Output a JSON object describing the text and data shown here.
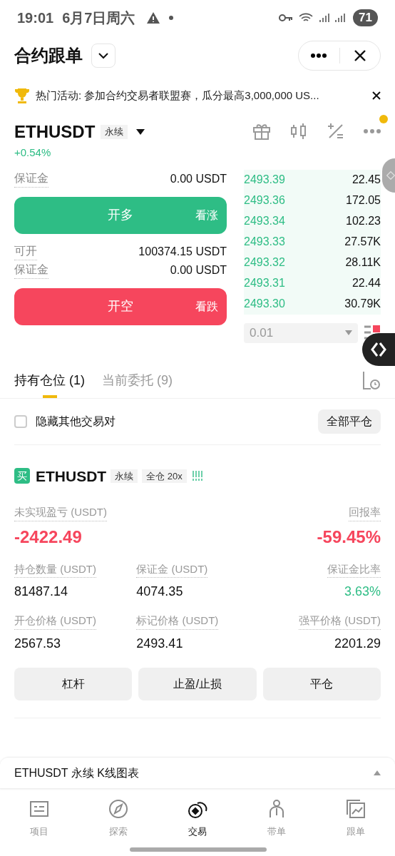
{
  "status_bar": {
    "time": "19:01",
    "date": "6月7日周六",
    "battery": "71"
  },
  "header": {
    "title": "合约跟单"
  },
  "banner": {
    "text": "热门活动: 参加合约交易者联盟赛，瓜分最高3,000,000 US..."
  },
  "ticker": {
    "symbol": "ETHUSDT",
    "type": "永续",
    "change": "+0.54%"
  },
  "order_form": {
    "sections": [
      {
        "kind": "long",
        "rows": [
          {
            "label": "保证金",
            "value": "0.00 USDT"
          }
        ],
        "button": "开多",
        "hint": "看涨"
      },
      {
        "kind": "short",
        "rows": [
          {
            "label": "可开",
            "value": "100374.15 USDT"
          },
          {
            "label": "保证金",
            "value": "0.00 USDT"
          }
        ],
        "button": "开空",
        "hint": "看跌"
      }
    ]
  },
  "order_book": {
    "rows": [
      {
        "price": "2493.39",
        "qty": "22.45"
      },
      {
        "price": "2493.36",
        "qty": "172.05"
      },
      {
        "price": "2493.34",
        "qty": "102.23"
      },
      {
        "price": "2493.33",
        "qty": "27.57K"
      },
      {
        "price": "2493.32",
        "qty": "28.11K"
      },
      {
        "price": "2493.31",
        "qty": "22.44"
      },
      {
        "price": "2493.30",
        "qty": "30.79K"
      }
    ],
    "precision": "0.01"
  },
  "tabs": [
    {
      "label": "持有仓位 (1)",
      "selected": true
    },
    {
      "label": "当前委托 (9)",
      "selected": false
    }
  ],
  "filter": {
    "label": "隐藏其他交易对",
    "checked": false,
    "close_all": "全部平仓"
  },
  "position": {
    "side": "买",
    "symbol": "ETHUSDT",
    "tags": [
      "永续",
      "全仓 20x"
    ],
    "pnl_label": "未实现盈亏 (USDT)",
    "pnl": "-2422.49",
    "roe_label": "回报率",
    "roe": "-59.45%",
    "stats": [
      {
        "label": "持仓数量 (USDT)",
        "value": "81487.14",
        "kind": "plain"
      },
      {
        "label": "保证金 (USDT)",
        "value": "4074.35",
        "kind": "plain"
      },
      {
        "label": "保证金比率",
        "value": "3.63%",
        "kind": "good"
      },
      {
        "label": "开仓价格 (USDT)",
        "value": "2567.53",
        "kind": "plain"
      },
      {
        "label": "标记价格 (USDT)",
        "value": "2493.41",
        "kind": "plain"
      },
      {
        "label": "强平价格 (USDT)",
        "value": "2201.29",
        "kind": "plain"
      }
    ],
    "buttons": [
      "杠杆",
      "止盈/止损",
      "平仓"
    ]
  },
  "chart_bar": {
    "label": "ETHUSDT 永续 K线图表"
  },
  "bottom_nav": [
    {
      "label": "项目",
      "selected": false
    },
    {
      "label": "探索",
      "selected": false
    },
    {
      "label": "交易",
      "selected": true
    },
    {
      "label": "带单",
      "selected": false
    },
    {
      "label": "跟单",
      "selected": false
    }
  ]
}
